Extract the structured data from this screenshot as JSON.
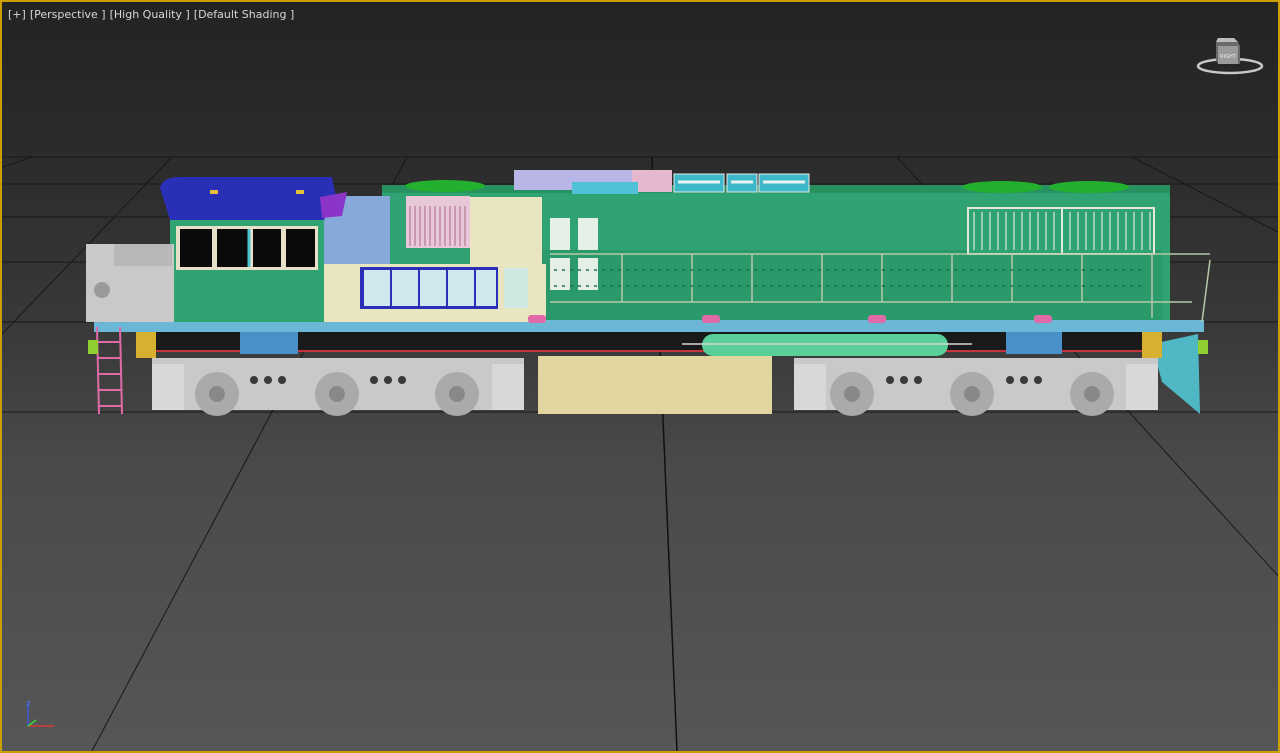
{
  "viewport": {
    "labels": [
      "[+]",
      "[Perspective ]",
      "[High Quality ]",
      "[Default Shading ]"
    ],
    "active_border_color": "#c8a000"
  },
  "viewcube": {
    "face_label": "RIGHT",
    "icon": "viewcube-icon"
  },
  "axis_tripod": {
    "icon": "axis-tripod-icon",
    "label": "z"
  },
  "model": {
    "type": "diesel locomotive",
    "shading": "default shading (flat colors per object)"
  },
  "colors": {
    "body_green": "#2fa472",
    "body_green_dark": "#238a5e",
    "cab_blue": "#2a2fb8",
    "cream": "#e9e5c0",
    "light_blue": "#86a9d9",
    "deck_blue": "#6ab7d6",
    "tank_yellow": "#e2d6a0",
    "bogie_grey": "#c9c9c9",
    "pink": "#e06aa8",
    "purple": "#8b35c8",
    "grid_line": "#191919"
  }
}
